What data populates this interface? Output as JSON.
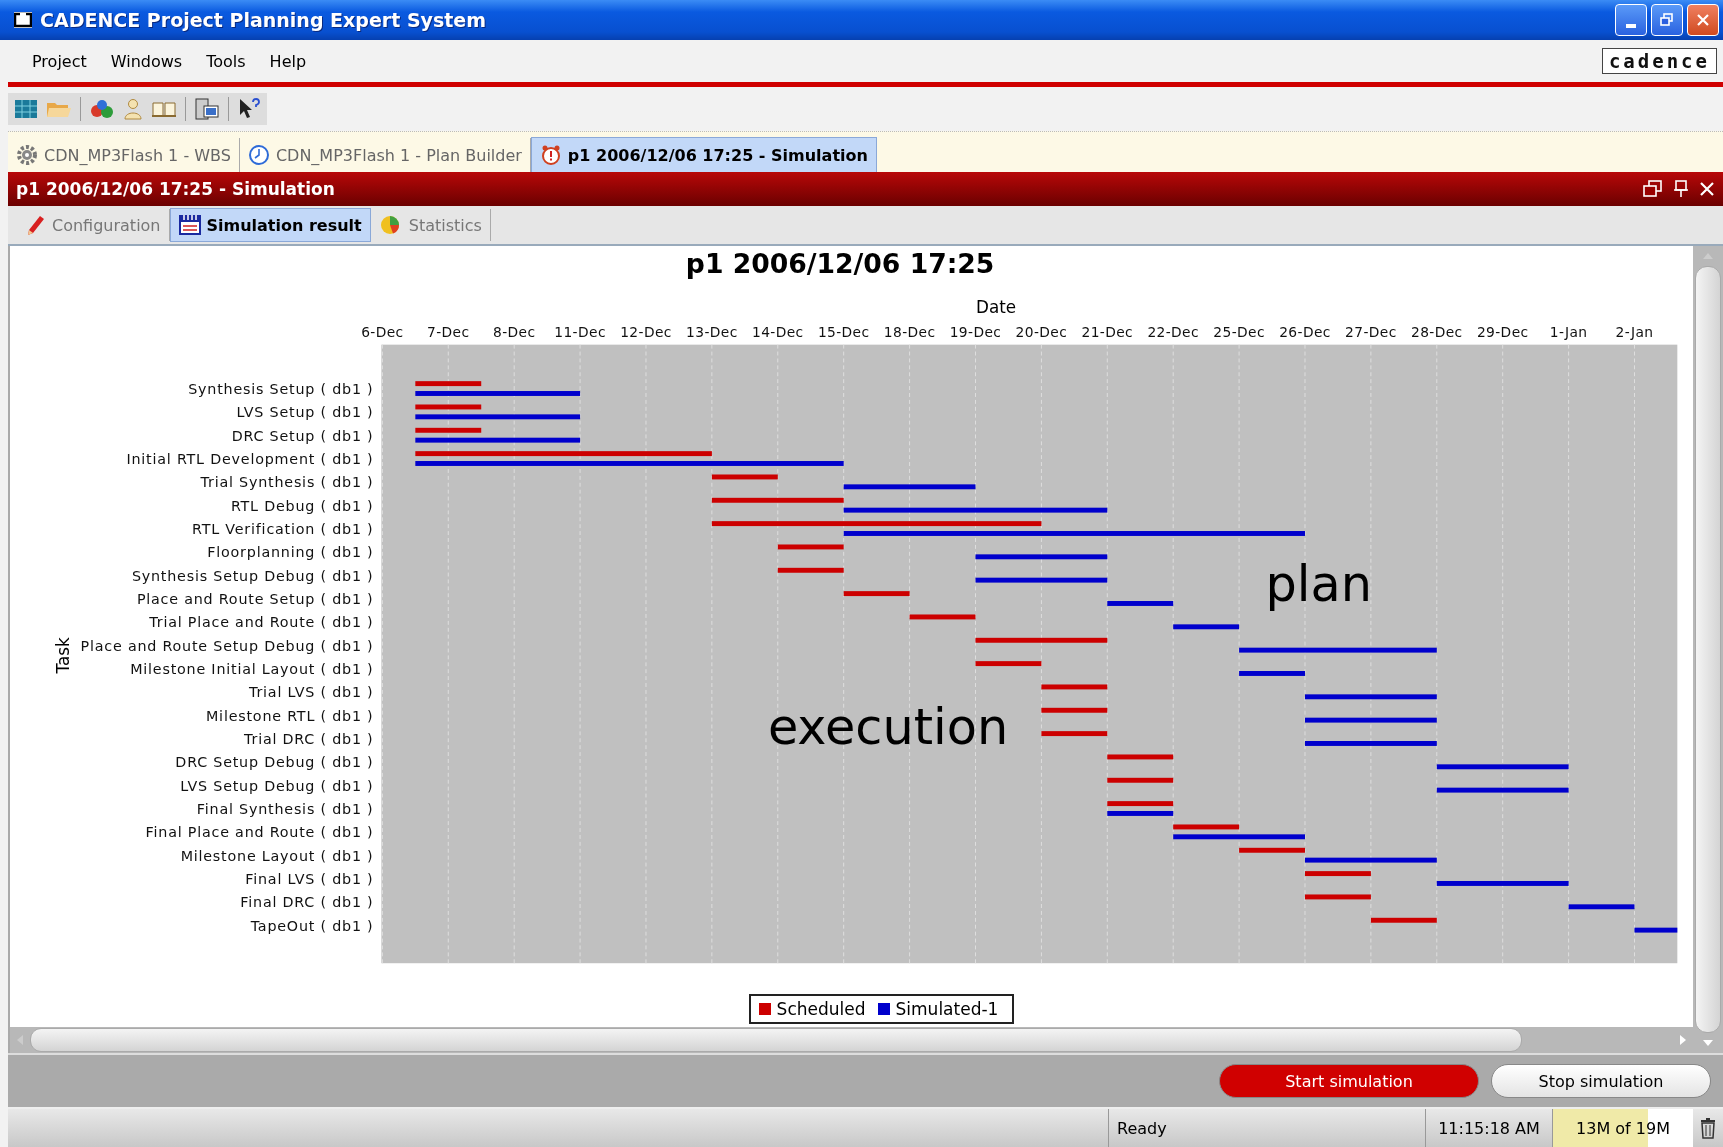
{
  "window": {
    "title": "CADENCE Project Planning Expert System"
  },
  "menu": [
    "Project",
    "Windows",
    "Tools",
    "Help"
  ],
  "logo": "cadence",
  "documents": [
    {
      "label": "CDN_MP3Flash 1 - WBS",
      "kind": "gear",
      "selected": false
    },
    {
      "label": "CDN_MP3Flash 1 - Plan Builder",
      "kind": "clock",
      "selected": false
    },
    {
      "label": "p1 2006/12/06 17:25 - Simulation",
      "kind": "alarm",
      "selected": true
    }
  ],
  "panel": {
    "title": "p1 2006/12/06 17:25 - Simulation"
  },
  "subtabs": [
    {
      "label": "Configuration",
      "kind": "pencil",
      "selected": false
    },
    {
      "label": "Simulation result",
      "kind": "calendar",
      "selected": true
    },
    {
      "label": "Statistics",
      "kind": "pie",
      "selected": false
    }
  ],
  "chart": {
    "title": "p1 2006/12/06 17:25",
    "xlabel": "Date",
    "ylabel": "Task",
    "dates": [
      "6-Dec",
      "7-Dec",
      "8-Dec",
      "11-Dec",
      "12-Dec",
      "13-Dec",
      "14-Dec",
      "15-Dec",
      "18-Dec",
      "19-Dec",
      "20-Dec",
      "21-Dec",
      "22-Dec",
      "25-Dec",
      "26-Dec",
      "27-Dec",
      "28-Dec",
      "29-Dec",
      "1-Jan",
      "2-Jan"
    ],
    "tasks": [
      "Synthesis Setup ( db1 )",
      "LVS Setup ( db1 )",
      "DRC Setup ( db1 )",
      "Initial RTL Development ( db1 )",
      "Trial Synthesis ( db1 )",
      "RTL Debug ( db1 )",
      "RTL Verification ( db1 )",
      "Floorplanning ( db1 )",
      "Synthesis Setup Debug ( db1 )",
      "Place and Route Setup ( db1 )",
      "Trial Place and Route ( db1 )",
      "Place and Route Setup Debug ( db1 )",
      "Milestone Initial Layout ( db1 )",
      "Trial LVS ( db1 )",
      "Milestone RTL ( db1 )",
      "Trial DRC ( db1 )",
      "DRC Setup Debug ( db1 )",
      "LVS Setup Debug ( db1 )",
      "Final Synthesis ( db1 )",
      "Final Place and Route ( db1 )",
      "Milestone Layout ( db1 )",
      "Final LVS ( db1 )",
      "Final DRC ( db1 )",
      "TapeOut ( db1 )"
    ],
    "legend": [
      {
        "name": "Scheduled",
        "color": "#cc0000"
      },
      {
        "name": "Simulated-1",
        "color": "#0000cc"
      }
    ],
    "annotations": [
      "plan",
      "execution"
    ]
  },
  "buttons": [
    {
      "label": "Start simulation",
      "kind": "primary"
    },
    {
      "label": "Stop simulation",
      "kind": "secondary"
    }
  ],
  "status_bar": {
    "status": "Ready",
    "time": "11:15:18 AM",
    "memory": {
      "text": "13M of 19M",
      "level": 0.68
    }
  }
}
